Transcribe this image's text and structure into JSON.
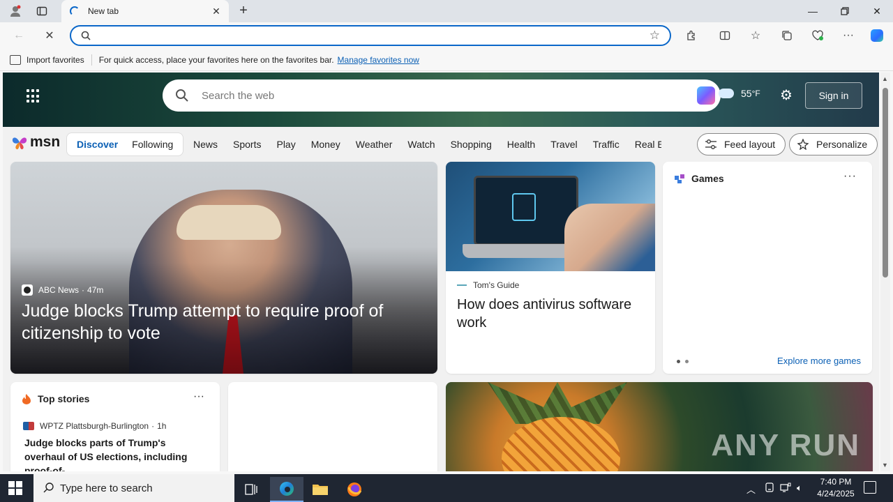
{
  "browser": {
    "tab_title": "New tab",
    "omnibox_value": "",
    "favorites_bar": {
      "import_label": "Import favorites",
      "hint": "For quick access, place your favorites here on the favorites bar.",
      "manage_link": "Manage favorites now"
    }
  },
  "msn": {
    "search_placeholder": "Search the web",
    "weather_temp": "55",
    "weather_unit": "°F",
    "signin_label": "Sign in",
    "logo_text": "msn",
    "feed_tabs": [
      "Discover",
      "Following"
    ],
    "categories": [
      "News",
      "Sports",
      "Play",
      "Money",
      "Weather",
      "Watch",
      "Shopping",
      "Health",
      "Travel",
      "Traffic",
      "Real E"
    ],
    "feed_layout_label": "Feed layout",
    "personalize_label": "Personalize"
  },
  "hero_story": {
    "source": "ABC News",
    "age": "47m",
    "headline": "Judge blocks Trump attempt to require proof of citizenship to vote"
  },
  "side_story": {
    "source": "Tom's Guide",
    "headline": "How does antivirus software work"
  },
  "games": {
    "title": "Games",
    "more": "···",
    "explore_label": "Explore more games"
  },
  "top_stories": {
    "title": "Top stories",
    "more": "···",
    "source": "WPTZ Plattsburgh-Burlington",
    "age": "1h",
    "headline": "Judge blocks parts of Trump's overhaul of US elections, including proof-of-..."
  },
  "watermark": "ANY RUN",
  "taskbar": {
    "search_placeholder": "Type here to search",
    "time": "7:40 PM",
    "date": "4/24/2025"
  },
  "colors": {
    "accent": "#0a67c9",
    "link": "#0a5fb4",
    "taskbar": "#1f2632"
  }
}
